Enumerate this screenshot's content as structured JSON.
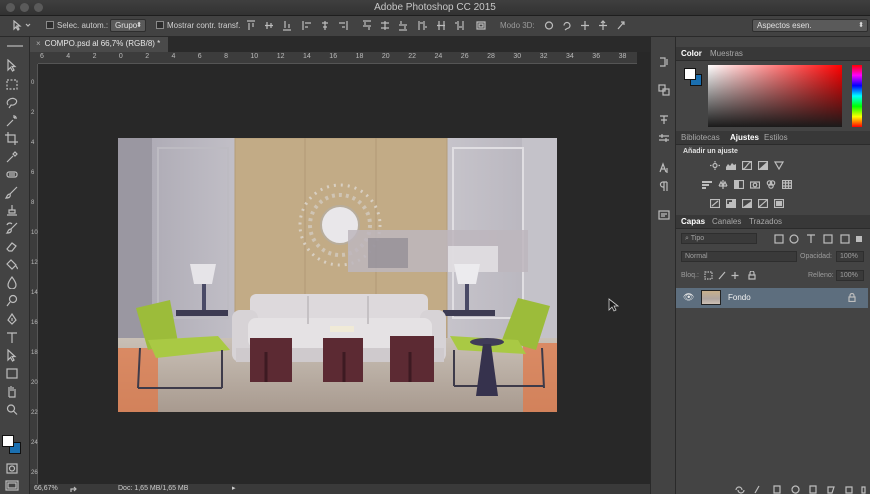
{
  "window": {
    "title": "Adobe Photoshop CC 2015"
  },
  "options_bar": {
    "auto_select_label": "Selec. autom.:",
    "auto_select_value": "Grupo",
    "show_transform_label": "Mostrar contr. transf.",
    "mode_3d_label": "Modo 3D:",
    "workspace": "Aspectos esen."
  },
  "document": {
    "tab_label": "COMPO.psd al 66,7% (RGB/8) *",
    "close_glyph": "×"
  },
  "rulers": {
    "top": [
      "6",
      "4",
      "2",
      "0",
      "2",
      "4",
      "6",
      "8",
      "10",
      "12",
      "14",
      "16",
      "18",
      "20",
      "22",
      "24",
      "26",
      "28",
      "30",
      "32",
      "34",
      "36",
      "38"
    ],
    "left": [
      "0",
      "2",
      "4",
      "6",
      "8",
      "10",
      "12",
      "14",
      "16",
      "18",
      "20",
      "22",
      "24",
      "26"
    ]
  },
  "status": {
    "zoom": "66,67%",
    "doc_info": "Doc: 1,65 MB/1,65 MB"
  },
  "panels": {
    "color_tabs": [
      "Color",
      "Muestras"
    ],
    "colors": {
      "foreground": "#ffffff",
      "background": "#1a6fb0",
      "picker_hue": "#ff0000"
    },
    "adjust_tabs": [
      "Bibliotecas",
      "Ajustes",
      "Estilos"
    ],
    "add_adjustment": "Añadir un ajuste",
    "layers_tabs": [
      "Capas",
      "Canales",
      "Trazados"
    ],
    "filter_kind": "Tipo",
    "blend_mode": "Normal",
    "opacity_label": "Opacidad:",
    "opacity_value": "100%",
    "lock_label": "Bloq.:",
    "fill_label": "Relleno:",
    "fill_value": "100%",
    "layers": [
      {
        "name": "Fondo",
        "visible": true,
        "locked": true
      }
    ]
  }
}
